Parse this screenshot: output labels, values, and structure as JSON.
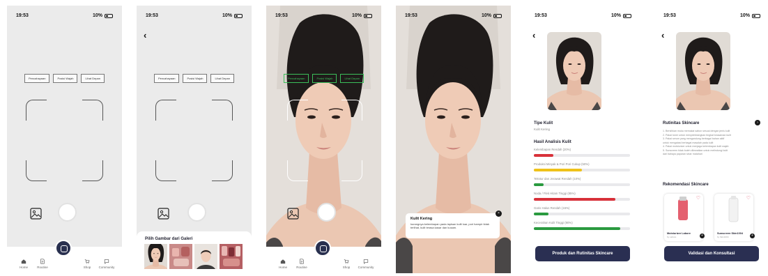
{
  "status": {
    "time": "19:53",
    "battery": "10%"
  },
  "capture": {
    "chips": [
      "Pencahayaan",
      "Posisi Wajah",
      "Lihat Depan"
    ]
  },
  "tabbar": {
    "home": "Home",
    "routine": "Routine",
    "shop": "Shop",
    "community": "Community"
  },
  "gallery_sheet": {
    "title": "Pilih Gambar dari Galeri"
  },
  "tooltip": {
    "title": "Kulit Kering",
    "text": "kurangnya kelembapan pada lapisan kulit luar, pori hampir tidak terlihat, kulit terasa kasar dan kusam."
  },
  "analysis": {
    "skin_type_heading": "Tipe Kulit",
    "skin_type_value": "Kulit Kering",
    "results_heading": "Hasil Analisis Kulit",
    "metrics": [
      {
        "label": "Kelembapan Rendah (20%)",
        "value": 20,
        "color": "#d8313a"
      },
      {
        "label": "Produksi Minyak & Pori Pori Cukup (50%)",
        "value": 50,
        "color": "#efc21a"
      },
      {
        "label": "Tekstur dan Jerawat Rendah (10%)",
        "value": 10,
        "color": "#2a9a3f"
      },
      {
        "label": "Noda / Flek Hitam Tinggi (85%)",
        "value": 85,
        "color": "#d8313a"
      },
      {
        "label": "Garis Halus Rendah (15%)",
        "value": 15,
        "color": "#2a9a3f"
      },
      {
        "label": "Kecerahan Kulit Tinggi (90%)",
        "value": 90,
        "color": "#2a9a3f"
      }
    ],
    "cta": "Produk dan Rutinitas Skincare"
  },
  "routine": {
    "heading": "Rutinitas Skincare",
    "steps": [
      "1. Bersihkan muka memakai sabun sesuai dengan jenis kulit",
      "2. Pakai toner untuk menyeimbangkan tingkat keasaman kulit",
      "3. Pakai serum yang mengandung berbagai bahan aktif",
      "untuk mengatasi berbagai masalah pada kulit",
      "4. Pakai moisturizer untuk menjaga kelembapan kulit wajah",
      "5. Sunscreen tidak boleh dilewatkan untuk melindungi kulit",
      "dari bahaya paparan sinar matahari"
    ],
    "rec_heading": "Rekomendasi Skincare",
    "products": [
      {
        "name": "Moisturizer Labore",
        "by": "by Labore",
        "bottle_color": "#e4606f"
      },
      {
        "name": "Sunscreen Skin1004",
        "by": "by Skin1004",
        "bottle_color": "#f2f2f2"
      }
    ],
    "cta": "Validasi dan Konsultasi"
  },
  "icons": {
    "home": "home-icon",
    "routine": "document-icon",
    "shop": "cart-icon",
    "community": "chat-icon",
    "gallery": "image-icon",
    "back": "chevron-left-icon",
    "close": "close-icon",
    "heart": "heart-icon"
  }
}
